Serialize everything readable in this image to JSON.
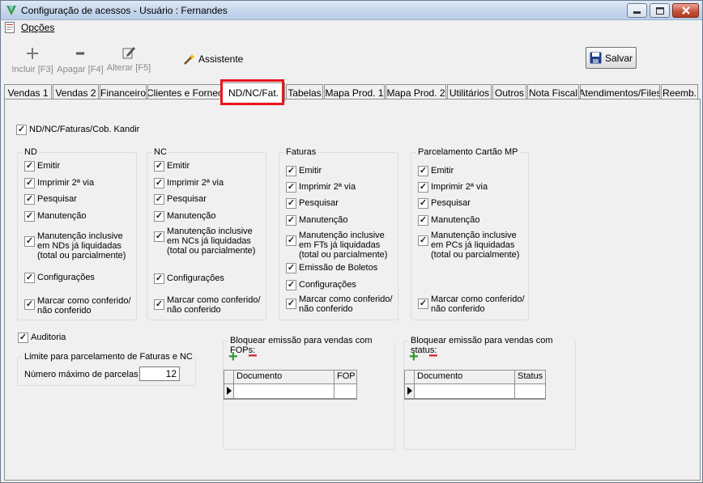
{
  "window": {
    "title": "Configuração de acessos - Usuário : Fernandes"
  },
  "menu": {
    "opcoes": "Opções"
  },
  "toolbar": {
    "incluir": "Incluir [F3]",
    "apagar": "Apagar [F4]",
    "alterar": "Alterar [F5]",
    "assistente": "Assistente",
    "salvar": "Salvar"
  },
  "tabs": [
    "Vendas 1",
    "Vendas 2",
    "Financeiro",
    "Clientes e Fornec",
    "ND/NC/Fat.",
    "Tabelas",
    "Mapa Prod. 1",
    "Mapa Prod. 2",
    "Utilitários",
    "Outros",
    "Nota Fiscal",
    "Atendimentos/Files",
    "Reemb."
  ],
  "active_tab": "ND/NC/Fat.",
  "main_check": "ND/NC/Faturas/Cob. Kandir",
  "groups": {
    "nd": {
      "title": "ND",
      "emitir": "Emitir",
      "imprimir": "Imprimir 2ª via",
      "pesquisar": "Pesquisar",
      "manutencao": "Manutenção",
      "manut_l1": "Manutenção inclusive",
      "manut_l2": "em NDs já liquidadas",
      "manut_l3": "(total ou parcialmente)",
      "config": "Configurações",
      "marcar_l1": "Marcar como conferido/",
      "marcar_l2": "não conferido"
    },
    "nc": {
      "title": "NC",
      "emitir": "Emitir",
      "imprimir": "Imprimir 2ª via",
      "pesquisar": "Pesquisar",
      "manutencao": "Manutenção",
      "manut_l1": "Manutenção inclusive",
      "manut_l2": "em NCs já liquidadas",
      "manut_l3": "(total ou parcialmente)",
      "config": "Configurações",
      "marcar_l1": "Marcar como conferido/",
      "marcar_l2": "não conferido"
    },
    "faturas": {
      "title": "Faturas",
      "emitir": "Emitir",
      "imprimir": "Imprimir 2ª via",
      "pesquisar": "Pesquisar",
      "manutencao": "Manutenção",
      "manut_l1": "Manutenção inclusive",
      "manut_l2": "em FTs já liquidadas",
      "manut_l3": "(total ou parcialmente)",
      "boletos": "Emissão de Boletos",
      "config": "Configurações",
      "marcar_l1": "Marcar como conferido/",
      "marcar_l2": "não conferido"
    },
    "parcelamento": {
      "title": "Parcelamento Cartão MP",
      "emitir": "Emitir",
      "imprimir": "Imprimir 2ª via",
      "pesquisar": "Pesquisar",
      "manutencao": "Manutenção",
      "manut_l1": "Manutenção inclusive",
      "manut_l2": "em PCs já liquidadas",
      "manut_l3": "(total ou parcialmente)",
      "marcar_l1": "Marcar como conferido/",
      "marcar_l2": "não conferido"
    }
  },
  "auditoria": "Auditoria",
  "limite": {
    "title": "Limite para parcelamento de Faturas e NC",
    "label": "Número máximo de parcelas",
    "value": "12"
  },
  "fops": {
    "title": "Bloquear emissão para vendas com FOPs:",
    "col1": "Documento",
    "col2": "FOP"
  },
  "status": {
    "title": "Bloquear emissão para vendas com status:",
    "col1": "Documento",
    "col2": "Status"
  },
  "colors": {
    "highlight": "#e8161e",
    "plus": "#2e9b2e",
    "minus": "#d52020"
  }
}
